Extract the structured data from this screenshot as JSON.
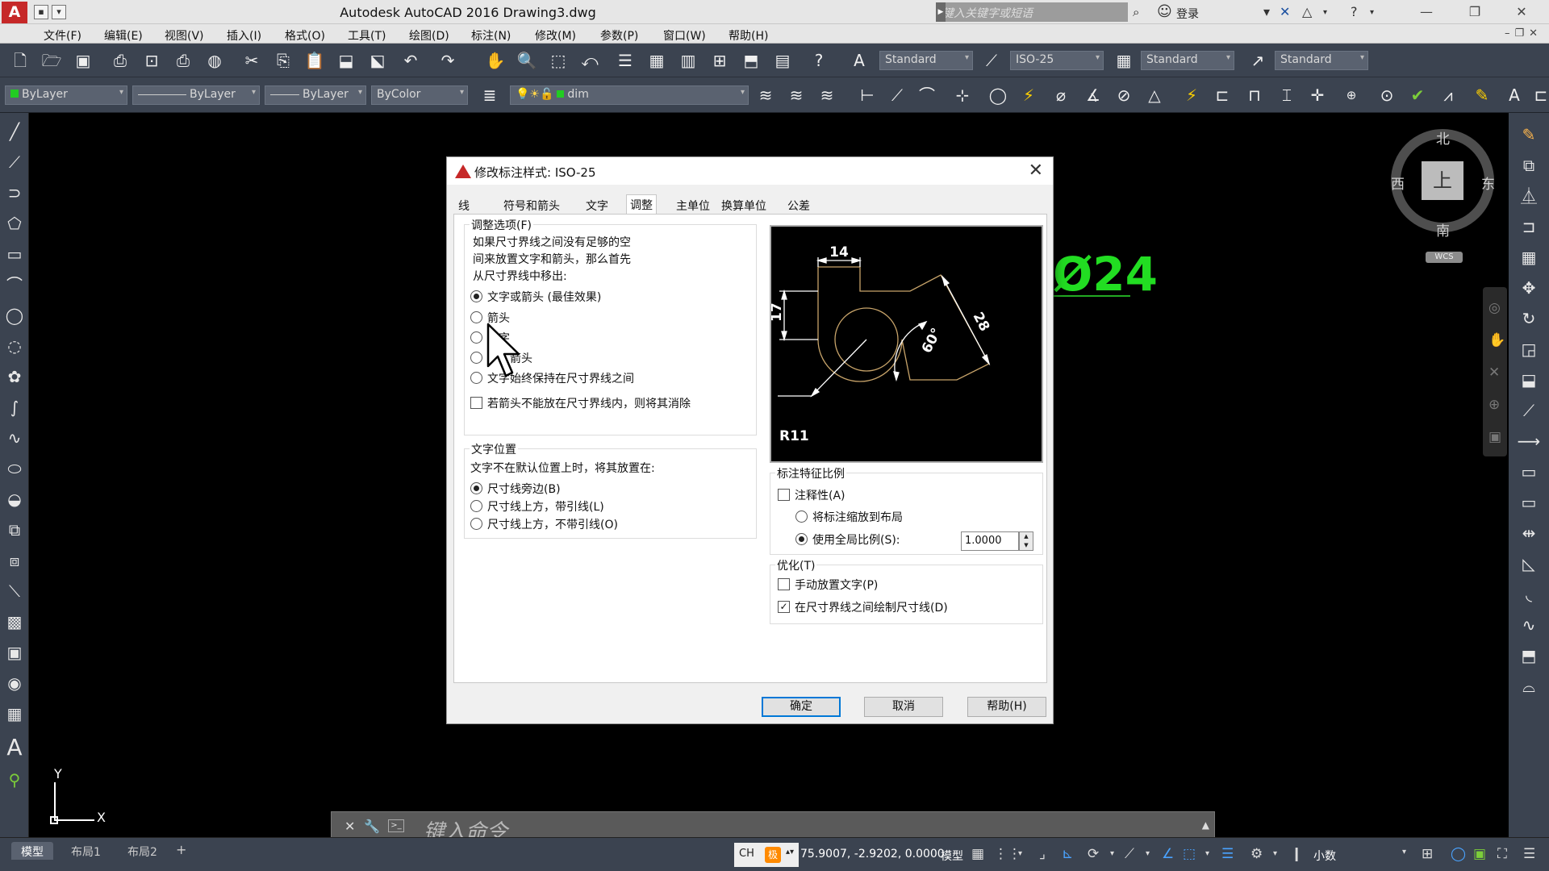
{
  "titlebar": {
    "app_logo": "A",
    "title": "Autodesk AutoCAD 2016    Drawing3.dwg",
    "search_placeholder": "键入关键字或短语",
    "login_label": "登录"
  },
  "menubar": {
    "items": [
      "文件(F)",
      "编辑(E)",
      "视图(V)",
      "插入(I)",
      "格式(O)",
      "工具(T)",
      "绘图(D)",
      "标注(N)",
      "修改(M)",
      "参数(P)",
      "窗口(W)",
      "帮助(H)"
    ]
  },
  "toolbar1": {
    "text_style": "Standard",
    "dim_style": "ISO-25",
    "table_style": "Standard",
    "mleader_style": "Standard"
  },
  "toolbar2": {
    "layer_color": "ByLayer",
    "linetype": "ByLayer",
    "lineweight": "ByLayer",
    "plot_style": "ByColor",
    "current_layer": "dim"
  },
  "canvas": {
    "dim_text": "Ø24",
    "viewcube": {
      "north": "北",
      "south": "南",
      "west": "西",
      "east": "东",
      "face": "上",
      "wcs": "WCS"
    },
    "ucs": {
      "x": "X",
      "y": "Y"
    }
  },
  "command_line": {
    "placeholder": "键入命令"
  },
  "statusbar": {
    "layout_tabs": [
      "模型",
      "布局1",
      "布局2"
    ],
    "add_tab": "+",
    "ime_lang": "CH",
    "ime_mode": "极",
    "coords": "75.9007, -2.9202, 0.0000",
    "space": "模型",
    "units": "小数"
  },
  "dialog": {
    "title": "修改标注样式: ISO-25",
    "tabs": [
      "线",
      "符号和箭头",
      "文字",
      "调整",
      "主单位",
      "换算单位",
      "公差"
    ],
    "active_tab": "调整",
    "fit_options": {
      "legend": "调整选项(F)",
      "description": [
        "如果尺寸界线之间没有足够的空",
        "间来放置文字和箭头，那么首先",
        "从尺寸界线中移出:"
      ],
      "options": [
        "文字或箭头 (最佳效果)",
        "箭头",
        "文字",
        "文字和箭头",
        "文字始终保持在尺寸界线之间"
      ],
      "visible_option_labels": [
        "文字或箭头 (最佳效果)",
        "箭头",
        "字",
        "箭头",
        "文字始终保持在尺寸界线之间"
      ],
      "selected_index": 0,
      "suppress_arrows_label": "若箭头不能放在尺寸界线内，则将其消除",
      "suppress_arrows_checked": false
    },
    "text_placement": {
      "legend": "文字位置",
      "description": "文字不在默认位置上时，将其放置在:",
      "options": [
        "尺寸线旁边(B)",
        "尺寸线上方，带引线(L)",
        "尺寸线上方，不带引线(O)"
      ],
      "selected_index": 0
    },
    "preview": {
      "labels": [
        "14",
        "17",
        "28",
        "60°",
        "R11"
      ]
    },
    "scale_for_features": {
      "legend": "标注特征比例",
      "annotative_label": "注释性(A)",
      "annotative_checked": false,
      "scale_to_layout_label": "将标注缩放到布局",
      "global_scale_label": "使用全局比例(S):",
      "global_scale_selected": true,
      "global_scale_value": "1.0000"
    },
    "fine_tuning": {
      "legend": "优化(T)",
      "manual_text_label": "手动放置文字(P)",
      "manual_text_checked": false,
      "draw_dim_line_label": "在尺寸界线之间绘制尺寸线(D)",
      "draw_dim_line_checked": true
    },
    "buttons": {
      "ok": "确定",
      "cancel": "取消",
      "help": "帮助(H)"
    }
  },
  "colors": {
    "ui_dark": "#3b4350",
    "canvas": "#000000",
    "dim_green": "#22dd22",
    "preview_lines": "#c8a46a",
    "accent_blue": "#0078d7",
    "logo_red": "#c62828"
  }
}
